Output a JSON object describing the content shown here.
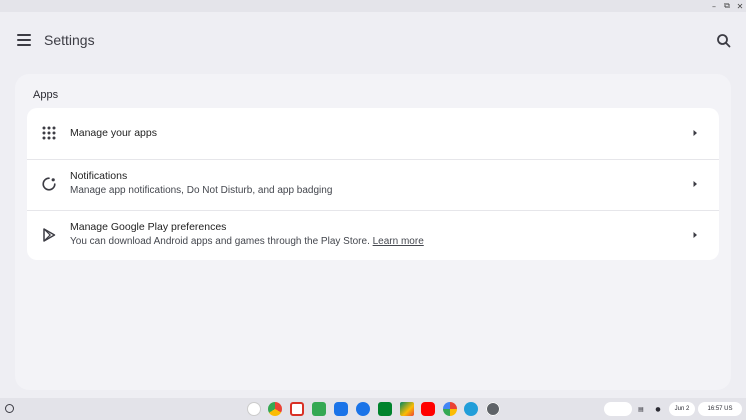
{
  "window": {
    "controls": {
      "minimize": "–",
      "restore": "⧉",
      "close": "✕"
    }
  },
  "appbar": {
    "title": "Settings",
    "menu_icon": "hamburger-menu-icon",
    "search_icon": "search-icon"
  },
  "section": {
    "title": "Apps",
    "rows": [
      {
        "title": "Manage your apps",
        "icon": "apps-grid-icon"
      },
      {
        "title": "Notifications",
        "subtitle": "Manage app notifications, Do Not Disturb, and app badging",
        "icon": "notifications-icon"
      },
      {
        "title": "Manage Google Play preferences",
        "subtitle": "You can download Android apps and games through the Play Store.",
        "link": "Learn more",
        "icon": "play-store-icon"
      }
    ]
  },
  "shelf": {
    "apps": [
      {
        "name": "gemini-icon",
        "color": "#4285f4"
      },
      {
        "name": "chrome-icon",
        "color": "#ea4335"
      },
      {
        "name": "gmail-icon",
        "color": "#d93025"
      },
      {
        "name": "docs-icon",
        "color": "#34a853"
      },
      {
        "name": "files-icon",
        "color": "#1a73e8"
      },
      {
        "name": "messages-icon",
        "color": "#1a73e8"
      },
      {
        "name": "meet-icon",
        "color": "#00832d"
      },
      {
        "name": "play-store-icon",
        "color": "#01875f"
      },
      {
        "name": "youtube-icon",
        "color": "#ff0000"
      },
      {
        "name": "photos-icon",
        "color": "#fbbc04"
      },
      {
        "name": "telegram-icon",
        "color": "#229ed9"
      },
      {
        "name": "settings-icon",
        "color": "#5f6368"
      }
    ],
    "date": "Jun 2",
    "time": "16:57",
    "locale": "US"
  }
}
